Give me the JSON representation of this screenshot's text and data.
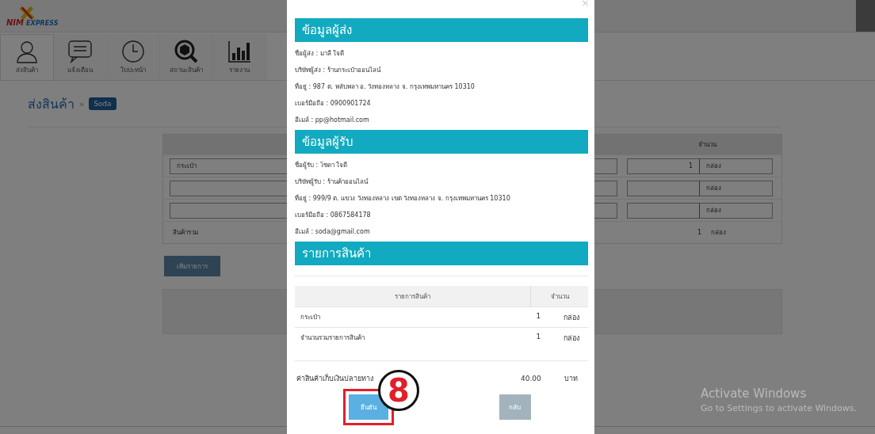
{
  "header": {
    "logo": {
      "brand": "NIM",
      "tagline": "EXPRESS"
    }
  },
  "tabs": [
    {
      "label": "ส่งสินค้า",
      "selected": true
    },
    {
      "label": "แจ้งเตือน",
      "selected": false
    },
    {
      "label": "ใบปะหน้า",
      "selected": false
    },
    {
      "label": "สถานะสินค้า",
      "selected": false
    },
    {
      "label": "รายงาน",
      "selected": false
    }
  ],
  "breadcrumb": {
    "page": "ส่งสินค้า",
    "separator": "»",
    "tag": "Soda"
  },
  "items_table": {
    "column_header": "จำนวน",
    "rows": [
      {
        "kind": "input",
        "name": "กระเป๋า",
        "quantity": "1",
        "unit": "กล่อง"
      },
      {
        "kind": "input",
        "unit": "กล่อง"
      },
      {
        "kind": "input",
        "unit": "กล่อง"
      },
      {
        "kind": "total",
        "label": "สินค้ารวม",
        "quantity": "1",
        "unit": "กล่อง"
      }
    ]
  },
  "add_button": "เพิ่มรายการ",
  "modal": {
    "close": "×",
    "sections": [
      {
        "title": "ข้อมูลผู้ส่ง",
        "lines": [
          "ชื่อผู้ส่ง : มาลี ใจดี",
          "บริษัทผู้ส่ง : ร้านกระเป๋าออนไลน์",
          "ที่อยู่ : 987 ต. พลับพลา อ. วังทองหลาง จ. กรุงเทพมหานคร 10310",
          "เบอร์มือถือ : 0900901724",
          "อีเมล์ : pp@hotmail.com"
        ]
      },
      {
        "title": "ข้อมูลผู้รับ",
        "lines": [
          "ชื่อผู้รับ : โซดา ใจดี",
          "บริษัทผู้รับ : ร้านค้าออนไลน์",
          "ที่อยู่ : 999/9 ต. แขวง วังทองหลาง เขต วังทองหลาง จ. กรุงเทพมหานคร 10310",
          "เบอร์มือถือ : 0867584178",
          "อีเมล์ : soda@gmail.com"
        ]
      }
    ],
    "products": {
      "title": "รายการสินค้า",
      "columns": [
        "รายการสินค้า",
        "จำนวน"
      ],
      "rows": [
        {
          "name": "กระเป๋า",
          "quantity": "1",
          "unit": "กล่อง"
        },
        {
          "name": "จำนวนรวมรายการสินค้า",
          "quantity": "1",
          "unit": "กล่อง"
        }
      ]
    },
    "cod": {
      "label": "ค่าสินค้าเก็บเงินปลายทาง",
      "amount": "40.00",
      "currency": "บาท"
    },
    "buttons": [
      {
        "label": "ยืนยัน",
        "kind": "primary",
        "highlighted": true
      },
      {
        "label": "กลับ",
        "kind": "secondary",
        "highlighted": false
      }
    ]
  },
  "callout": {
    "number": "8"
  },
  "os_notice": {
    "title": "Activate Windows",
    "subtitle": "Go to Settings to activate Windows."
  }
}
